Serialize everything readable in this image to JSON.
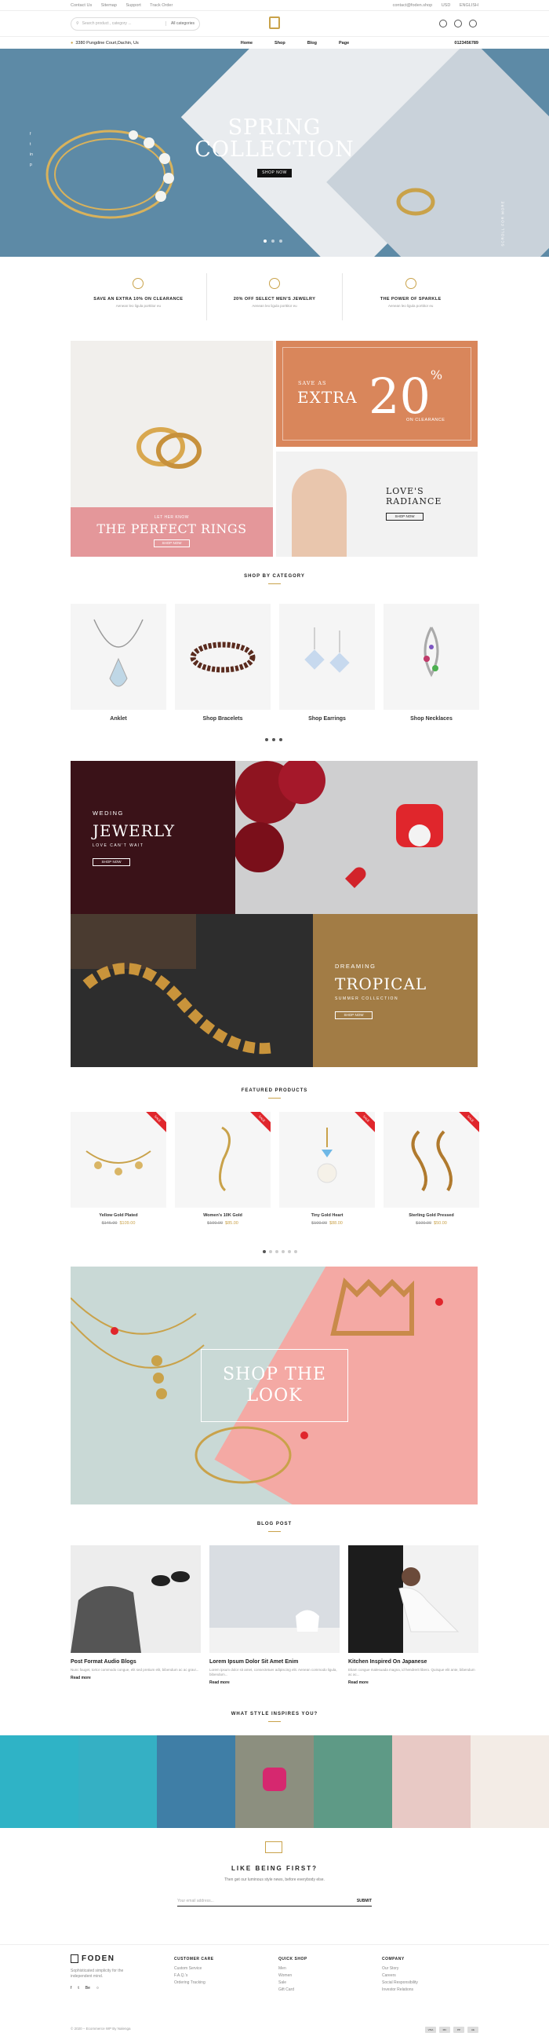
{
  "topbar": {
    "links": [
      "Contact Us",
      "Sitemap",
      "Support",
      "Track Order"
    ],
    "email": "contact@foden.shop",
    "currency": "USD",
    "language": "ENGLISH"
  },
  "header": {
    "search_placeholder": "Search product , category ...",
    "search_category": "All categories",
    "cart_count": "0"
  },
  "nav": {
    "address": "3380 Pungdine Court,Dachin, Us",
    "menu": [
      "Home",
      "Shop",
      "Blog",
      "Page"
    ],
    "phone": "0123456789"
  },
  "hero": {
    "title_line1": "SPRING",
    "title_line2": "COLLECTION",
    "button": "SHOP NOW",
    "social": [
      "f",
      "t",
      "in",
      "p"
    ],
    "scroll_label": "SCROLL FOR MORE"
  },
  "features": [
    {
      "title": "SAVE AN EXTRA 10% ON CLEARANCE",
      "sub": "Aenean leo ligula porttitor eu"
    },
    {
      "title": "20% OFF SELECT MEN'S JEWELRY",
      "sub": "Aenean leo ligula porttitor eu"
    },
    {
      "title": "THE POWER OF SPARKLE",
      "sub": "Aenean leo ligula porttitor eu"
    }
  ],
  "banners": {
    "rings_sub": "LET HER KNOW",
    "rings_title": "THE PERFECT RINGS",
    "rings_btn": "SHOP NOW",
    "extra_save": "SAVE AS",
    "extra_word": "EXTRA",
    "extra_pct": "20",
    "extra_sign": "%",
    "extra_clearance": "ON CLEARANCE",
    "love_line1": "LOVE'S",
    "love_line2": "RADIANCE",
    "love_btn": "SHOP NOW",
    "wed_sub": "WEDING",
    "wed_title": "JEWERLY",
    "wed_tag": "LOVE CAN'T WAIT",
    "wed_btn": "SHOP NOW",
    "trop_sub": "DREAMING",
    "trop_title": "TROPICAL",
    "trop_tag": "SUMMER COLLECTION",
    "trop_btn": "SHOP NOW",
    "look_line1": "SHOP THE",
    "look_line2": "LOOK"
  },
  "categories": {
    "title": "SHOP BY CATEGORY",
    "items": [
      "Anklet",
      "Shop Bracelets",
      "Shop Earrings",
      "Shop Necklaces"
    ]
  },
  "featured": {
    "title": "FEATURED PRODUCTS",
    "items": [
      {
        "name": "Yellow Gold Plated",
        "old": "$146.00",
        "new": "$109.00",
        "tag": "SALE"
      },
      {
        "name": "Women's 10K Gold",
        "old": "$100.00",
        "new": "$85.00",
        "tag": "SALE"
      },
      {
        "name": "Tiny Gold Heart",
        "old": "$100.00",
        "new": "$88.00",
        "tag": "SALE"
      },
      {
        "name": "Sterling Gold Pressed",
        "old": "$100.00",
        "new": "$50.00",
        "tag": "SALE"
      }
    ]
  },
  "blog": {
    "title": "BLOG POST",
    "items": [
      {
        "title": "Post Format Audio Blogs",
        "desc": "Nunc fauget, tortor commodo congue, elit sed pretium elit, bibendum ac ac gravi...",
        "more": "Read more"
      },
      {
        "title": "Lorem Ipsum Dolor Sit Amet Enim",
        "desc": "Lorem ipsum dolor sit amet, consectetuer adipiscing elit. Aenean commodo ligula, bibendum...",
        "more": "Read more"
      },
      {
        "title": "Kitchen Inspired On Japanese",
        "desc": "Etiam congue malesuada magna, id hendrerit libero. Quisque elit ante, bibendum ac ac...",
        "more": "Read more"
      }
    ]
  },
  "instagram": {
    "title": "WHAT STYLE INSPIRES YOU?"
  },
  "newsletter": {
    "title": "LIKE BEING FIRST?",
    "sub": "Then get our luminous style news, before everybody else.",
    "placeholder": "Your email address...",
    "button": "SUBMIT"
  },
  "footer": {
    "brand": "FODEN",
    "desc": "Sophisticated simplicity for the independent mind.",
    "social": [
      "f",
      "t",
      "Be",
      "○"
    ],
    "cols": [
      {
        "title": "CUSTOMER CARE",
        "items": [
          "Custom Service",
          "F.A.Q.'s",
          "Ordering Tracking"
        ]
      },
      {
        "title": "QUICK SHOP",
        "items": [
          "Men",
          "Women",
          "Sale",
          "Gift Card"
        ]
      },
      {
        "title": "COMPANY",
        "items": [
          "Our Story",
          "Careers",
          "Social Responsibility",
          "Investor Relations"
        ]
      }
    ],
    "copyright": "© 2020 – Ecommerce WP By Nalenga",
    "cards": [
      "VISA",
      "MC",
      "PP",
      "AE"
    ]
  },
  "colors": {
    "accent": "#c9a24a",
    "hero_bg": "#5d8aa6",
    "sale_tag": "#e0262c"
  }
}
